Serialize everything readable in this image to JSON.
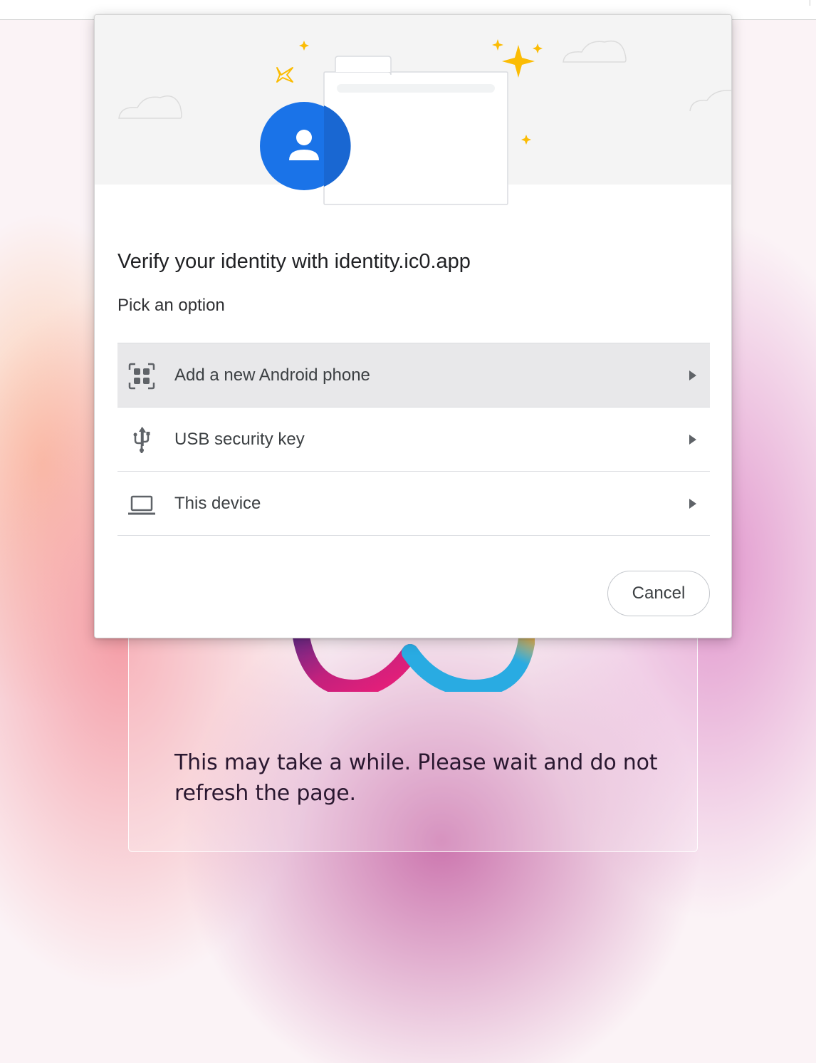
{
  "dialog": {
    "title": "Verify your identity with identity.ic0.app",
    "subtitle": "Pick an option",
    "options": [
      {
        "label": "Add a new Android phone",
        "icon": "qr-code-icon",
        "selected": true
      },
      {
        "label": "USB security key",
        "icon": "usb-icon",
        "selected": false
      },
      {
        "label": "This device",
        "icon": "laptop-icon",
        "selected": false
      }
    ],
    "cancel_label": "Cancel"
  },
  "background_page": {
    "message": "This may take a while. Please wait and do not refresh the page."
  },
  "colors": {
    "accent_blue": "#1a73e8",
    "sparkle_yellow": "#fbbc04",
    "selected_row": "#e8e8ea"
  }
}
